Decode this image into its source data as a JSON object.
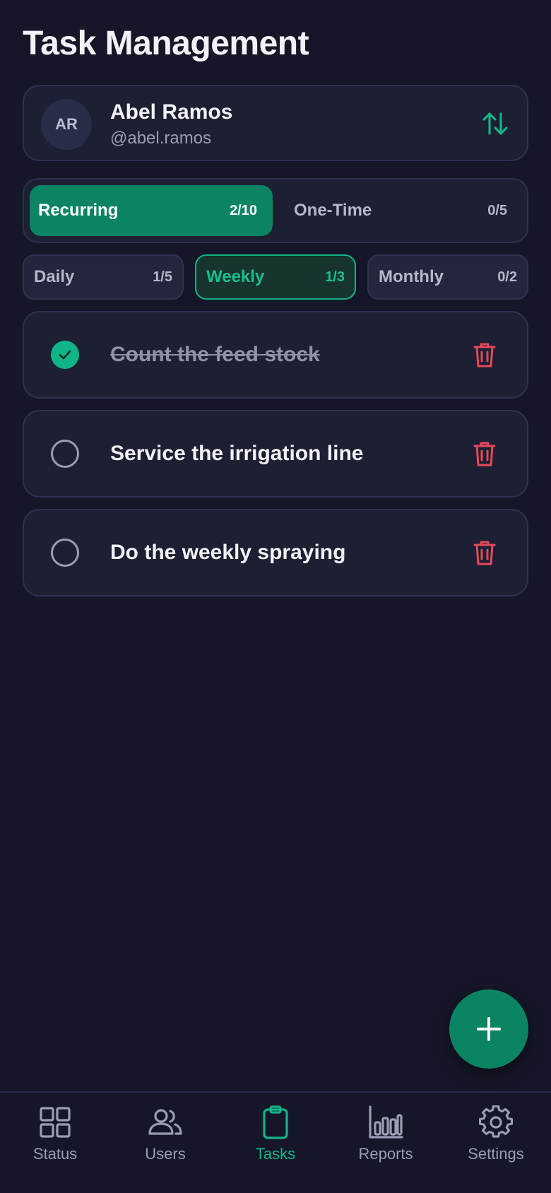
{
  "page_title": "Task Management",
  "user": {
    "initials": "AR",
    "name": "Abel Ramos",
    "handle": "@abel.ramos",
    "switch_icon": "swap-vertical-icon"
  },
  "type_tabs": [
    {
      "label": "Recurring",
      "count": "2/10",
      "active": true
    },
    {
      "label": "One-Time",
      "count": "0/5",
      "active": false
    }
  ],
  "frequency_tabs": [
    {
      "label": "Daily",
      "count": "1/5",
      "active": false
    },
    {
      "label": "Weekly",
      "count": "1/3",
      "active": true
    },
    {
      "label": "Monthly",
      "count": "0/2",
      "active": false
    }
  ],
  "tasks": [
    {
      "text": "Count the feed stock",
      "done": true
    },
    {
      "text": "Service the irrigation line",
      "done": false
    },
    {
      "text": "Do the weekly spraying",
      "done": false
    }
  ],
  "fab": {
    "icon": "plus-icon"
  },
  "nav": [
    {
      "label": "Status",
      "icon": "grid-icon",
      "active": false
    },
    {
      "label": "Users",
      "icon": "users-icon",
      "active": false
    },
    {
      "label": "Tasks",
      "icon": "clipboard-icon",
      "active": true
    },
    {
      "label": "Reports",
      "icon": "bar-chart-icon",
      "active": false
    },
    {
      "label": "Settings",
      "icon": "gear-icon",
      "active": false
    }
  ],
  "colors": {
    "background": "#151728",
    "card": "#1d1f33",
    "accent": "#0a8463",
    "accent_bright": "#12b386",
    "danger": "#e5485b",
    "muted_text": "#9a9db3"
  }
}
